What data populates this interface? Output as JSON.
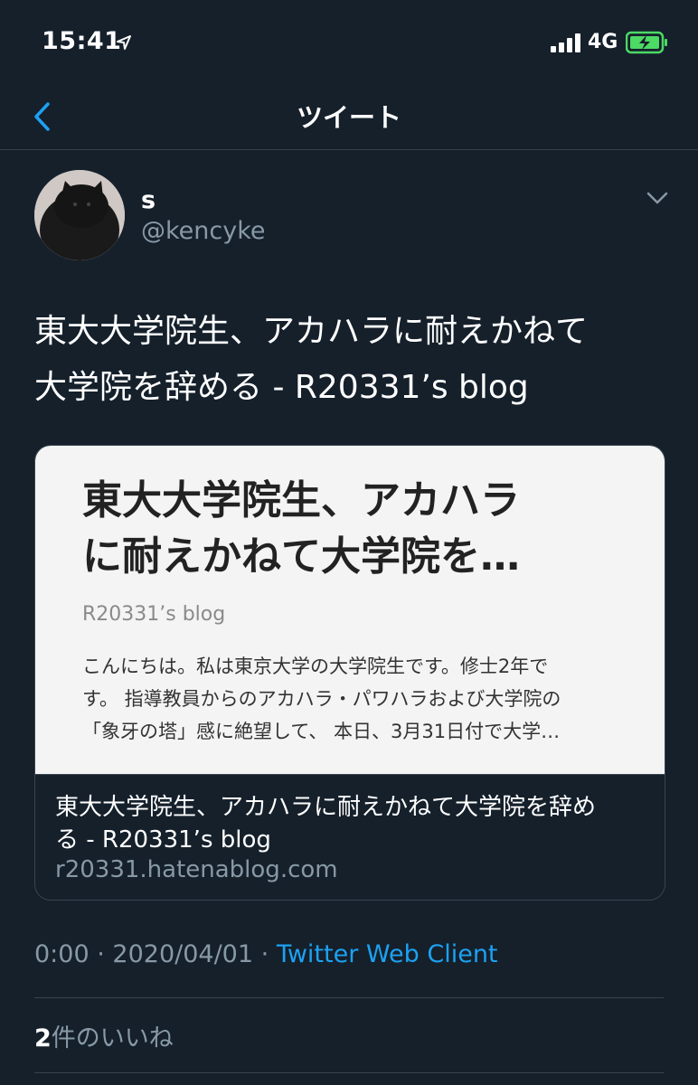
{
  "status_bar": {
    "time": "15:41",
    "network": "4G",
    "icons": [
      "location-arrow-icon",
      "cellular-signal-icon",
      "charging-battery-icon"
    ]
  },
  "nav": {
    "title": "ツイート",
    "back_icon": "chevron-left-icon"
  },
  "tweet": {
    "author": {
      "name": "s",
      "handle": "@kencyke"
    },
    "text_lines": [
      "東大大学院生、アカハラに耐えかねて",
      "大学院を辞める - R20331’s blog"
    ],
    "card": {
      "preview_title_lines": [
        "東大大学院生、アカハラ",
        "に耐えかねて大学院を…"
      ],
      "preview_site": "R20331’s blog",
      "preview_excerpt_lines": [
        "こんにちは。私は東京大学の大学院生です。修士2年で",
        "す。 指導教員からのアカハラ・パワハラおよび大学院の",
        "「象牙の塔」感に絶望して、 本日、3月31日付で大学…"
      ],
      "title_lines": [
        "東大大学院生、アカハラに耐えかねて大学院を辞め",
        "る - R20331’s blog"
      ],
      "domain": "r20331.hatenablog.com"
    },
    "time": "0:00",
    "date": "2020/04/01",
    "separator": "·",
    "client": "Twitter Web Client",
    "likes_count": "2",
    "likes_label": "件のいいね"
  },
  "colors": {
    "background": "#15202b",
    "text": "#ffffff",
    "secondary_text": "#8899a6",
    "accent": "#1da1f2",
    "border": "#38444d",
    "battery": "#4cd964"
  }
}
